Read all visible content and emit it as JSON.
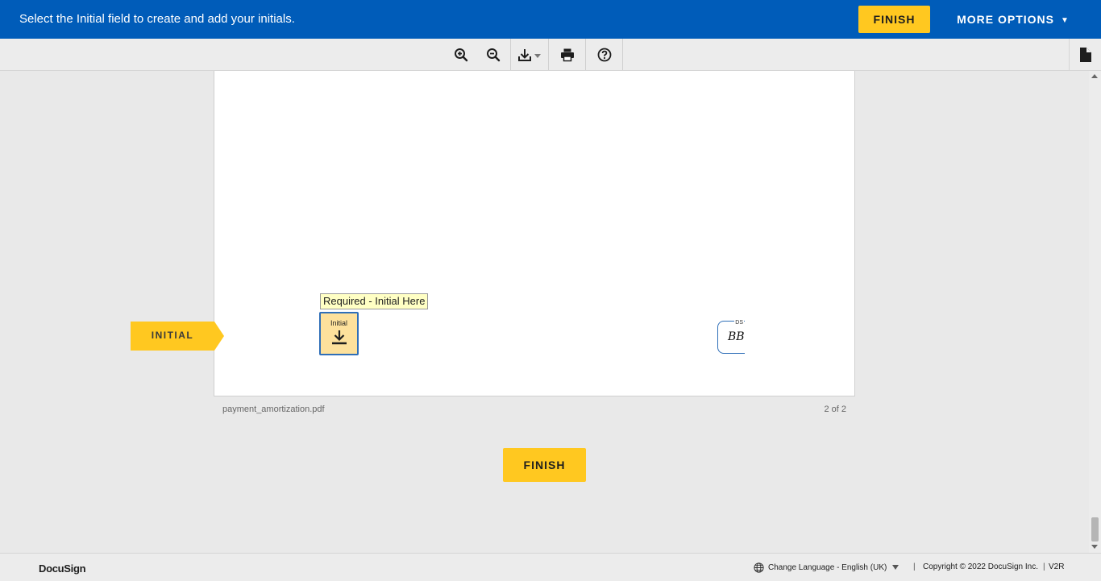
{
  "banner": {
    "message": "Select the Initial field to create and add your initials.",
    "finish_label": "FINISH",
    "more_options_label": "MORE OPTIONS",
    "background_color": "#005cb9",
    "accent_color": "#ffc820"
  },
  "toolbar": {
    "items": [
      "zoom-in-icon",
      "zoom-out-icon",
      "download-icon",
      "print-icon",
      "help-icon"
    ],
    "right_icon": "document-icon"
  },
  "document": {
    "tooltip": "Required - Initial Here",
    "initial_field_label": "Initial",
    "indicator_label": "INITIAL",
    "stamp_tag": "DS",
    "stamp_initials": "BB",
    "filename": "payment_amortization.pdf",
    "page_count": "2 of 2",
    "finish_label": "FINISH"
  },
  "footer": {
    "logo": "DocuSign",
    "language": "Change Language - English (UK)",
    "copyright": "Copyright © 2022 DocuSign Inc.",
    "version": "V2R"
  }
}
